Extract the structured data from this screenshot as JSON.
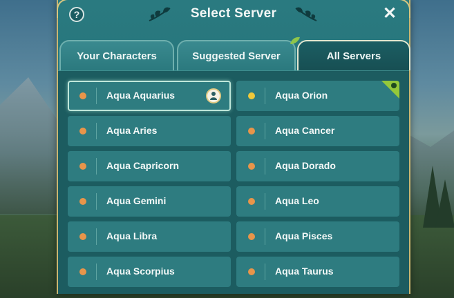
{
  "header": {
    "title": "Select Server",
    "help_label": "?",
    "close_label": "✕"
  },
  "tabs": [
    {
      "label": "Your Characters",
      "active": false
    },
    {
      "label": "Suggested Server",
      "active": false
    },
    {
      "label": "All Servers",
      "active": true
    }
  ],
  "colors": {
    "status_orange": "#e8954a",
    "status_yellow": "#f0c93a",
    "new_badge_green": "#94c83a"
  },
  "servers": [
    {
      "name": "Aqua Aquarius",
      "status": "orange",
      "selected": true,
      "has_character": true
    },
    {
      "name": "Aqua Orion",
      "status": "yellow",
      "is_new": true
    },
    {
      "name": "Aqua Aries",
      "status": "orange"
    },
    {
      "name": "Aqua Cancer",
      "status": "orange"
    },
    {
      "name": "Aqua Capricorn",
      "status": "orange"
    },
    {
      "name": "Aqua Dorado",
      "status": "orange"
    },
    {
      "name": "Aqua Gemini",
      "status": "orange"
    },
    {
      "name": "Aqua Leo",
      "status": "orange"
    },
    {
      "name": "Aqua Libra",
      "status": "orange"
    },
    {
      "name": "Aqua Pisces",
      "status": "orange"
    },
    {
      "name": "Aqua Scorpius",
      "status": "orange"
    },
    {
      "name": "Aqua Taurus",
      "status": "orange"
    }
  ]
}
